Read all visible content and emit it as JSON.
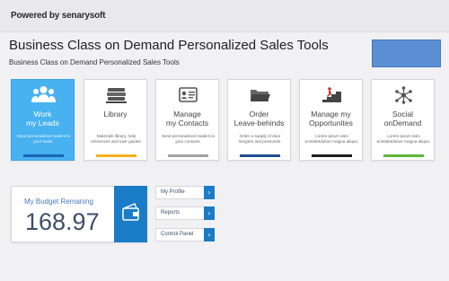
{
  "header": {
    "powered_by": "Powered by senarysoft"
  },
  "page": {
    "title": "Business Class on Demand Personalized Sales Tools",
    "subtitle": "Business Class on Demand Personalized Sales Tools"
  },
  "colors": {
    "accent": "#48b1f0",
    "primary_blue": "#1a7cc6",
    "top_button": "#5b8fd3"
  },
  "tiles": [
    {
      "label": "Work my Leads",
      "desc": "Send personalized mailers to your leads.",
      "icon": "people-icon",
      "bar_color": "#1a64b6",
      "active": true
    },
    {
      "label": "Library",
      "desc": "Materials library, help references and user guides.",
      "icon": "books-icon",
      "bar_color": "#f2b21c",
      "active": false
    },
    {
      "label": "Manage my Contacts",
      "desc": "Send personalized mailers to your contacts.",
      "icon": "contact-card-icon",
      "bar_color": "#a0a0a5",
      "active": false
    },
    {
      "label": "Order Leave-behinds",
      "desc": "Order a supply of door hangers and postcards.",
      "icon": "folder-icon",
      "bar_color": "#1f4d91",
      "active": false
    },
    {
      "label": "Manage my Opportunites",
      "desc": "Lorem ipsum dolo ectetdetdolore magna aliqua.",
      "icon": "stairs-climber-icon",
      "bar_color": "#1e1e1e",
      "active": false
    },
    {
      "label": "Social onDemand",
      "desc": "Lorem ipsum dolo ectetdetdolore magna aliqua.",
      "icon": "network-icon",
      "bar_color": "#5fb63a",
      "active": false
    }
  ],
  "budget": {
    "label": "My Budget Remaning",
    "value": "168.97",
    "icon": "wallet-icon"
  },
  "links": [
    {
      "label": "My Profile",
      "icon": "chevron-right-icon"
    },
    {
      "label": "Reports",
      "icon": "chevron-right-icon"
    },
    {
      "label": "Control Panel",
      "icon": "chevron-right-icon"
    }
  ]
}
